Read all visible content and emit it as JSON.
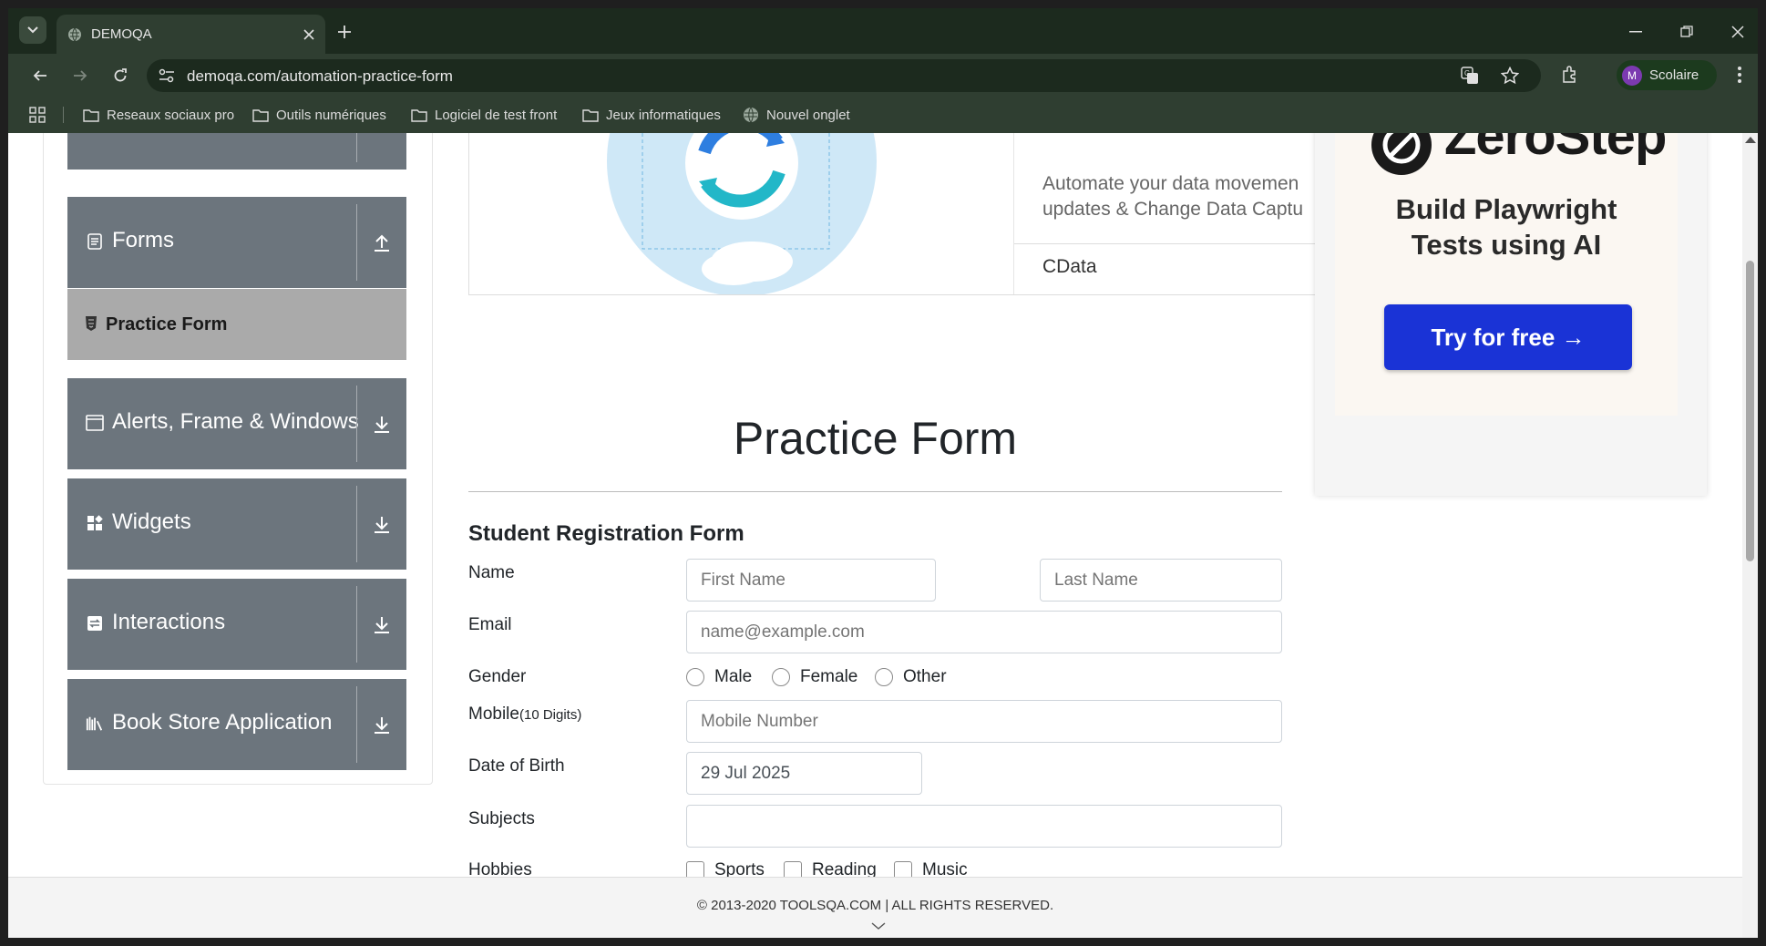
{
  "browser": {
    "tab_title": "DEMOQA",
    "url": "demoqa.com/automation-practice-form",
    "profile_initial": "M",
    "profile_name": "Scolaire",
    "bookmarks": [
      "Reseaux sociaux pro",
      "Outils numériques",
      "Logiciel de test front",
      "Jeux informatiques",
      "Nouvel onglet"
    ]
  },
  "sidebar": {
    "groups": [
      {
        "label": "Forms",
        "icon": "document-icon",
        "arrow": "arrow-up-icon"
      },
      {
        "label": "Alerts, Frame & Windows",
        "icon": "window-icon",
        "arrow": "arrow-down-icon"
      },
      {
        "label": "Widgets",
        "icon": "widgets-icon",
        "arrow": "arrow-down-icon"
      },
      {
        "label": "Interactions",
        "icon": "interactions-icon",
        "arrow": "arrow-down-icon"
      },
      {
        "label": "Book Store Application",
        "icon": "books-icon",
        "arrow": "arrow-down-icon"
      }
    ],
    "active_item": "Practice Form"
  },
  "ad_banner": {
    "text_line1": "Automate your data movemen",
    "text_line2": "updates & Change Data Captu",
    "brand": "CData"
  },
  "ad_right": {
    "brand": "ZeroStep",
    "headline_line1": "Build Playwright",
    "headline_line2": "Tests using AI",
    "cta": "Try for free →"
  },
  "form": {
    "title": "Practice Form",
    "subtitle": "Student Registration Form",
    "name_label": "Name",
    "first_name_placeholder": "First Name",
    "last_name_placeholder": "Last Name",
    "email_label": "Email",
    "email_placeholder": "name@example.com",
    "gender_label": "Gender",
    "gender_options": [
      "Male",
      "Female",
      "Other"
    ],
    "mobile_label": "Mobile",
    "mobile_hint": "(10 Digits)",
    "mobile_placeholder": "Mobile Number",
    "dob_label": "Date of Birth",
    "dob_value": "29 Jul 2025",
    "subjects_label": "Subjects",
    "subjects_value": "",
    "hobbies_label": "Hobbies",
    "hobby_options": [
      "Sports",
      "Reading",
      "Music"
    ]
  },
  "footer": {
    "text": "© 2013-2020 TOOLSQA.COM | ALL RIGHTS RESERVED."
  },
  "colors": {
    "sidebar_group": "#6c757d",
    "sidebar_active": "#aaaaaa",
    "cta": "#1a33d6",
    "chrome_dark": "#1c2a1e"
  }
}
